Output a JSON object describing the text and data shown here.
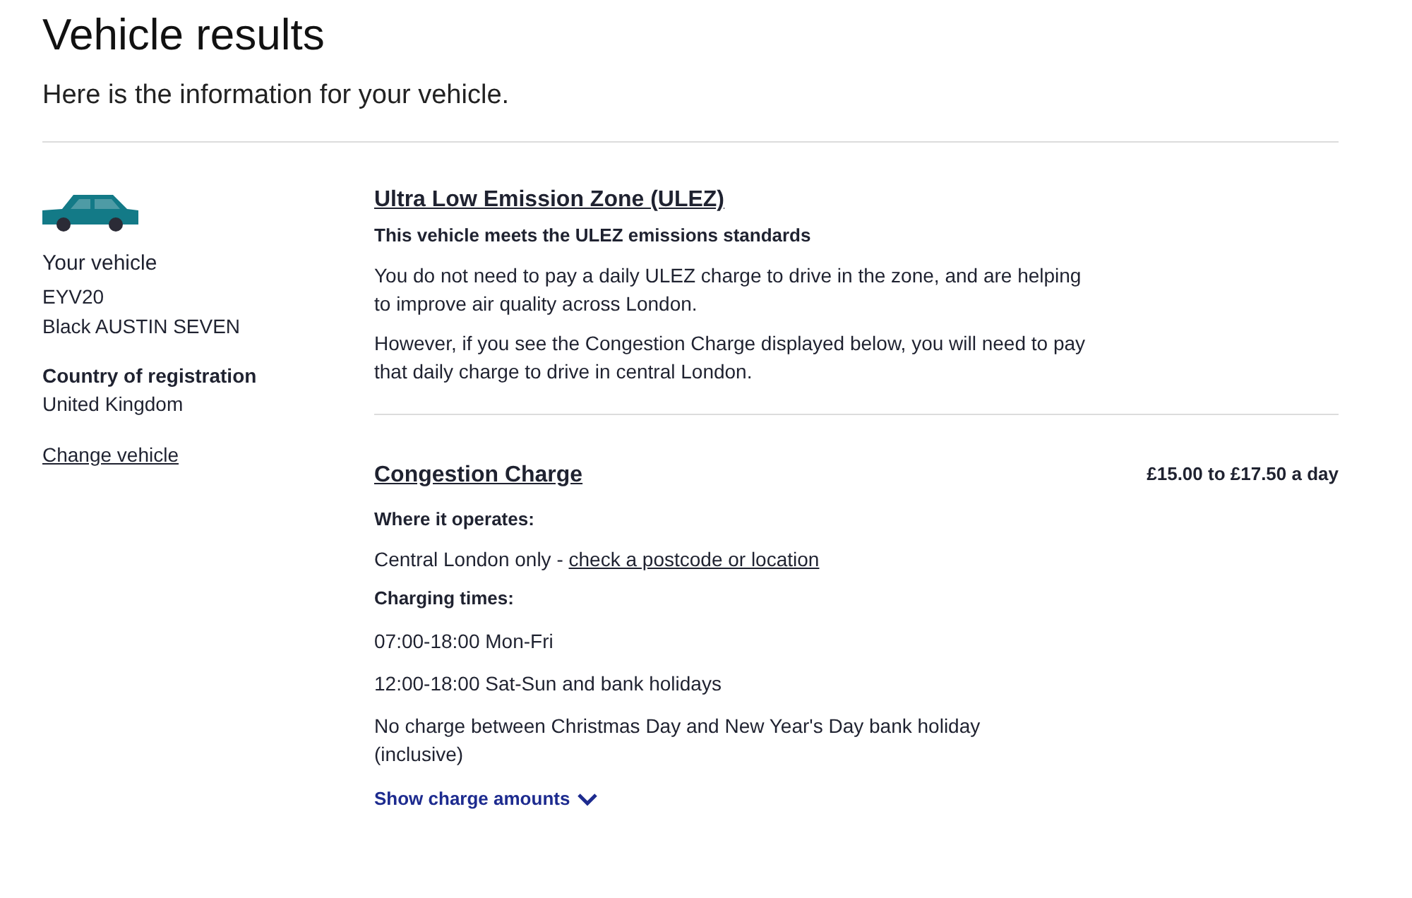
{
  "heading": {
    "title": "Vehicle results",
    "subtitle": "Here is the information for your vehicle."
  },
  "vehicle": {
    "label": "Your vehicle",
    "registration": "EYV20",
    "description": "Black AUSTIN SEVEN",
    "country_label": "Country of registration",
    "country": "United Kingdom",
    "change_link": "Change vehicle"
  },
  "ulez": {
    "title": "Ultra Low Emission Zone (ULEZ)",
    "status": "This vehicle meets the ULEZ emissions standards",
    "paragraphs": [
      "You do not need to pay a daily ULEZ charge to drive in the zone, and are helping to improve air quality across London.",
      "However, if you see the Congestion Charge displayed below, you will need to pay that daily charge to drive in central London."
    ]
  },
  "congestion": {
    "title": "Congestion Charge",
    "price": "£15.00 to £17.50 a day",
    "where_label": "Where it operates:",
    "where_text": "Central London only - ",
    "where_link": "check a postcode or location",
    "times_label": "Charging times:",
    "times": [
      "07:00-18:00 Mon-Fri",
      "12:00-18:00 Sat-Sun and bank holidays",
      "No charge between Christmas Day and New Year's Day bank holiday (inclusive)"
    ],
    "toggle": {
      "label": "Show charge amounts",
      "expanded": false
    }
  }
}
